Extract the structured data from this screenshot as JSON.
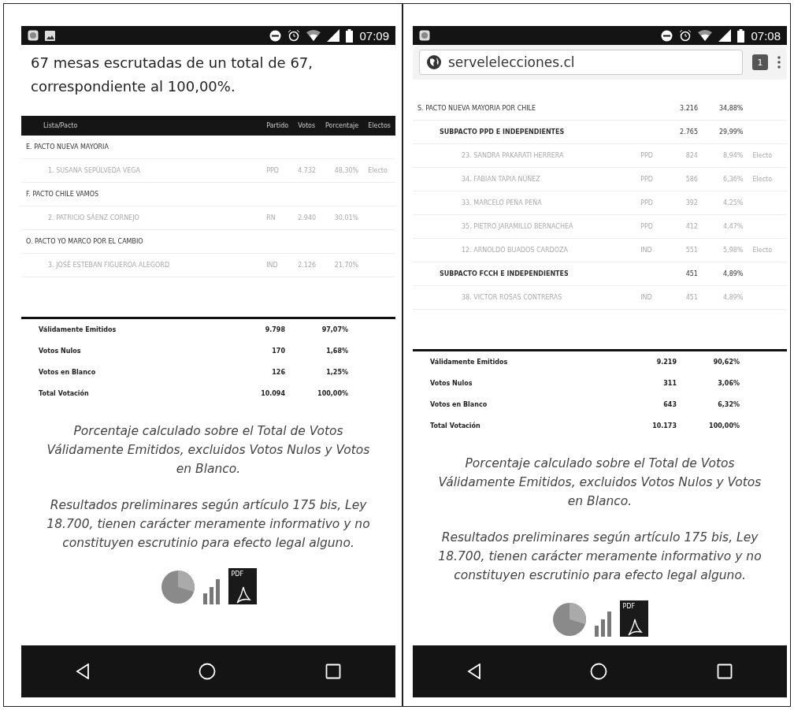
{
  "screens": [
    {
      "status_bar": {
        "time": "07:09"
      },
      "summary": "67 mesas escrutadas de un total de 67, correspondiente al 100,00%.",
      "table": {
        "columns": [
          "Lista/Pacto",
          "Partido",
          "Votos",
          "Porcentaje",
          "Electos"
        ],
        "rows": [
          {
            "kind": "pacto",
            "name": "E. PACTO NUEVA MAYORIA",
            "children": [
              {
                "kind": "candidate",
                "name": "1. SUSANA SEPÚLVEDA VEGA",
                "party": "PPD",
                "votes": "4.732",
                "percent": "48,30%",
                "elected": "Electo"
              }
            ]
          },
          {
            "kind": "pacto",
            "name": "F. PACTO CHILE VAMOS",
            "children": [
              {
                "kind": "candidate",
                "name": "2. PATRICIO SÁENZ CORNEJO",
                "party": "RN",
                "votes": "2.940",
                "percent": "30,01%"
              }
            ]
          },
          {
            "kind": "pacto",
            "name": "O. PACTO YO MARCO POR EL CAMBIO",
            "children": [
              {
                "kind": "candidate",
                "name": "3. JOSÉ ESTEBAN FIGUEROA ALEGORD",
                "party": "IND",
                "votes": "2.126",
                "percent": "21,70%"
              }
            ]
          }
        ]
      },
      "totals": [
        {
          "label": "Válidamente Emitidos",
          "votes": "9.798",
          "percent": "97,07%"
        },
        {
          "label": "Votos Nulos",
          "votes": "170",
          "percent": "1,68%"
        },
        {
          "label": "Votos en Blanco",
          "votes": "126",
          "percent": "1,25%"
        },
        {
          "label": "Total Votación",
          "votes": "10.094",
          "percent": "100,00%"
        }
      ],
      "notes": [
        "Porcentaje calculado sobre el Total de Votos Válidamente Emitidos, excluidos Votos Nulos y Votos en Blanco.",
        "Resultados preliminares según artículo 175 bis, Ley 18.700, tienen carácter meramente informativo y no constituyen escrutinio para efecto legal alguno."
      ],
      "pdf_label": "PDF"
    },
    {
      "status_bar": {
        "time": "07:08"
      },
      "address_bar": {
        "url": "servelelecciones.cl",
        "tab_count": "1"
      },
      "table": {
        "rows": [
          {
            "kind": "pacto",
            "name": "S. PACTO NUEVA MAYORIA POR CHILE",
            "votes": "3.216",
            "percent": "34,88%",
            "children": [
              {
                "kind": "subpacto",
                "name": "SUBPACTO PPD E INDEPENDIENTES",
                "votes": "2.765",
                "percent": "29,99%",
                "children": [
                  {
                    "kind": "candidate",
                    "name": "23. SANDRA PAKARATI HERRERA",
                    "party": "PPD",
                    "votes": "824",
                    "percent": "8,94%",
                    "elected": "Electo"
                  },
                  {
                    "kind": "candidate",
                    "name": "34. FABIAN TAPIA NÚÑEZ",
                    "party": "PPD",
                    "votes": "586",
                    "percent": "6,36%",
                    "elected": "Electo"
                  },
                  {
                    "kind": "candidate",
                    "name": "33. MARCELO PEÑA PEÑA",
                    "party": "PPD",
                    "votes": "392",
                    "percent": "4,25%"
                  },
                  {
                    "kind": "candidate",
                    "name": "35. PIETRO JARAMILLO BERNACHEA",
                    "party": "PPD",
                    "votes": "412",
                    "percent": "4,47%"
                  },
                  {
                    "kind": "candidate",
                    "name": "12. ARNOLDO BUADOS CARDOZA",
                    "party": "IND",
                    "votes": "551",
                    "percent": "5,98%",
                    "elected": "Electo"
                  }
                ]
              },
              {
                "kind": "subpacto",
                "name": "SUBPACTO FCCH E INDEPENDIENTES",
                "votes": "451",
                "percent": "4,89%",
                "children": [
                  {
                    "kind": "candidate",
                    "name": "38. VICTOR ROSAS CONTRERAS",
                    "party": "IND",
                    "votes": "451",
                    "percent": "4,89%"
                  }
                ]
              }
            ]
          }
        ]
      },
      "totals": [
        {
          "label": "Válidamente Emitidos",
          "votes": "9.219",
          "percent": "90,62%"
        },
        {
          "label": "Votos Nulos",
          "votes": "311",
          "percent": "3,06%"
        },
        {
          "label": "Votos en Blanco",
          "votes": "643",
          "percent": "6,32%"
        },
        {
          "label": "Total Votación",
          "votes": "10.173",
          "percent": "100,00%"
        }
      ],
      "notes": [
        "Porcentaje calculado sobre el Total de Votos Válidamente Emitidos, excluidos Votos Nulos y Votos en Blanco.",
        "Resultados preliminares según artículo 175 bis, Ley 18.700, tienen carácter meramente informativo y no constituyen escrutinio para efecto legal alguno."
      ],
      "pdf_label": "PDF"
    }
  ]
}
